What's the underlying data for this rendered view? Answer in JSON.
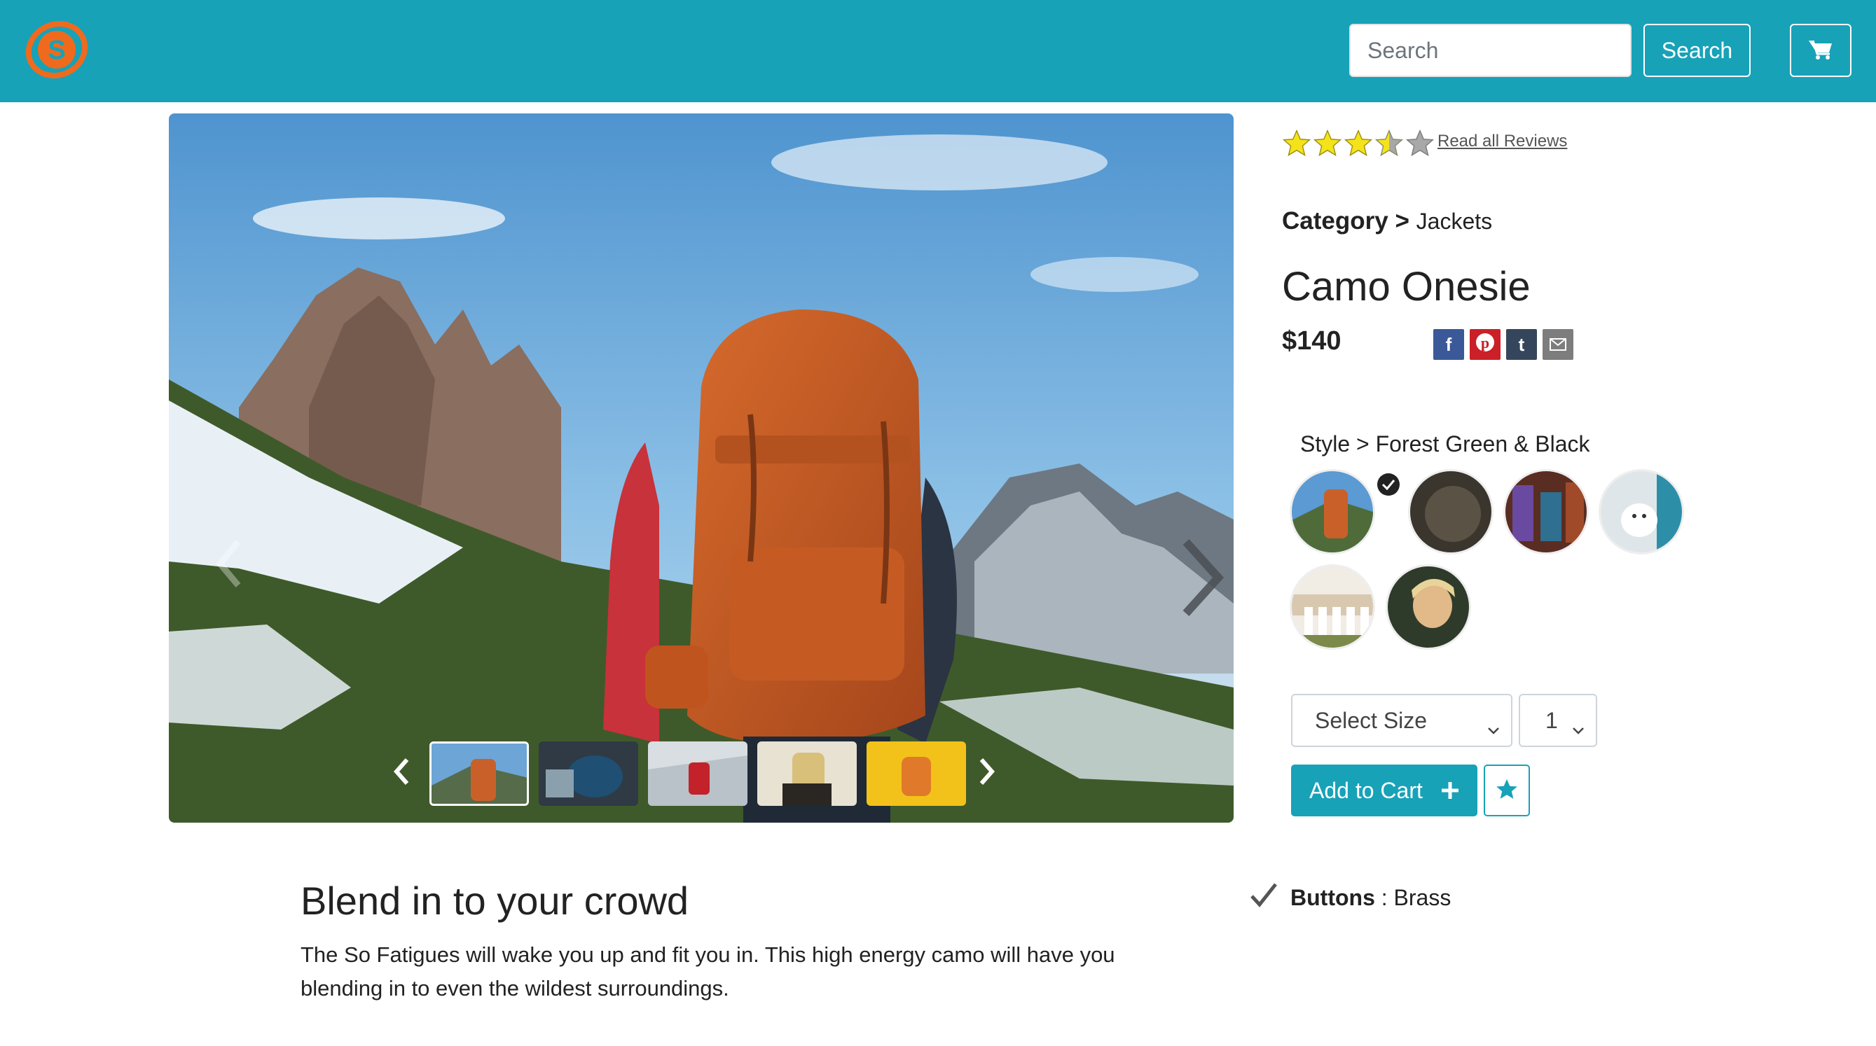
{
  "header": {
    "brand_letter": "S",
    "search": {
      "placeholder": "Search",
      "value": ""
    },
    "search_button_label": "Search",
    "cart_icon": "shopping-cart-icon"
  },
  "carousel": {
    "prev_icon": "chevron-left-icon",
    "next_icon": "chevron-right-icon",
    "thumb_prev_icon": "chevron-left-icon",
    "thumb_next_icon": "chevron-right-icon",
    "active_thumbnail_index": 0,
    "thumbnail_count": 5
  },
  "product": {
    "rating": 3.5,
    "rating_max": 5,
    "reviews_link": "Read all Reviews",
    "category_label": "Category",
    "category_separator": ">",
    "category_value": "Jackets",
    "title": "Camo Onesie",
    "price": "$140",
    "share": [
      "f",
      "p",
      "t",
      "mail-icon"
    ],
    "style_label": "Style",
    "style_separator": ">",
    "style_value": "Forest Green & Black",
    "selected_swatch_index": 0,
    "size_select": "Select Size",
    "quantity_select": "1",
    "add_to_cart_label": "Add to Cart"
  },
  "description": {
    "title": "Blend in to your crowd",
    "body": "The So Fatigues will wake you up and fit you in. This high energy camo will have you blending in to even the wildest surroundings."
  },
  "features": [
    {
      "label": "Buttons",
      "separator": " : ",
      "value": "Brass"
    }
  ],
  "colors": {
    "brand": "#17a2b8",
    "logo_orange": "#f06a1d",
    "star_gold": "#f4e31a",
    "facebook": "#3b5998",
    "pinterest": "#cb2027",
    "tumblr": "#35465c",
    "email": "#7d7d7d"
  }
}
